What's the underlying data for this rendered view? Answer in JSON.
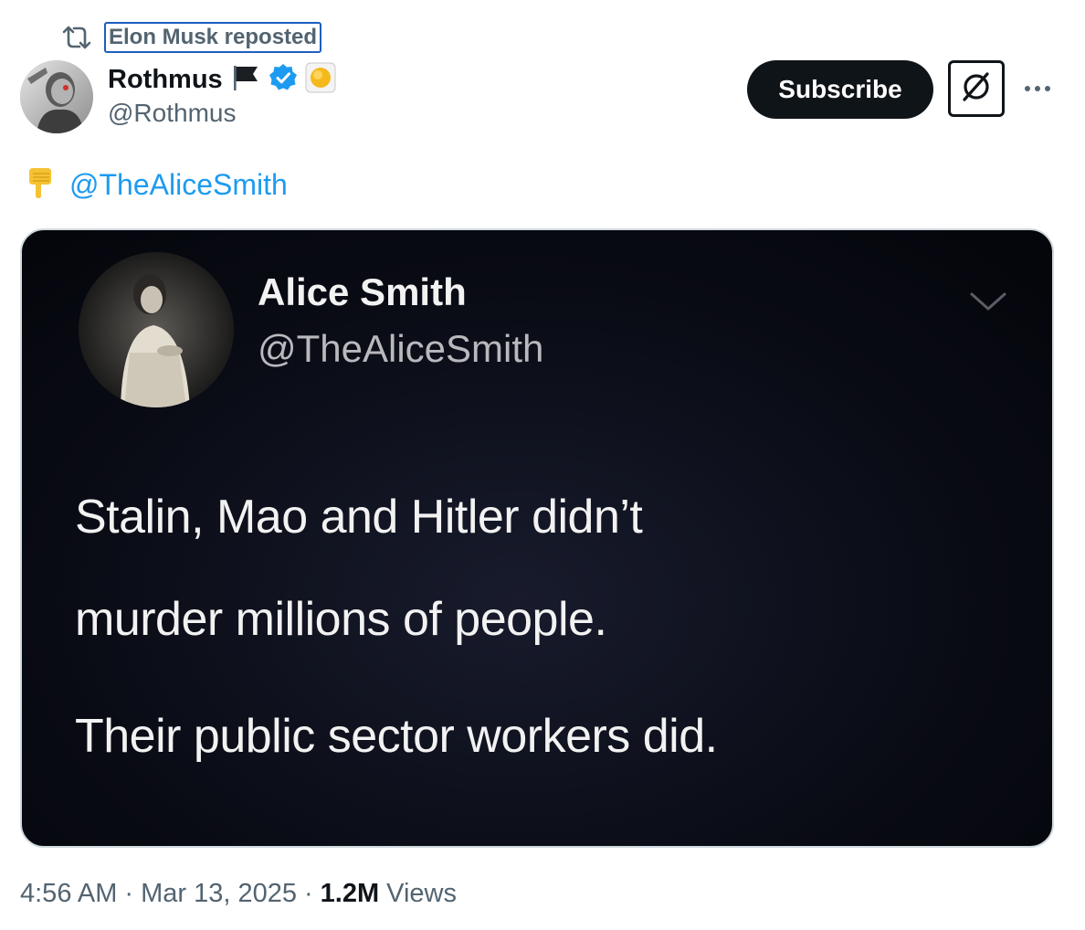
{
  "repost": {
    "icon": "repost-icon",
    "label": "Elon Musk reposted"
  },
  "post": {
    "author": {
      "display_name": "Rothmus",
      "handle": "@Rothmus",
      "badges": [
        "flag-icon",
        "verified-badge-icon",
        "yellow-circle-icon"
      ],
      "verified_color": "#1d9bf0"
    },
    "subscribe_label": "Subscribe",
    "grok_icon": "grok-icon",
    "more_icon": "more-options-icon",
    "text": {
      "emoji": "👇",
      "mention": "@TheAliceSmith"
    },
    "media": {
      "author_name": "Alice Smith",
      "author_handle": "@TheAliceSmith",
      "lines": [
        "Stalin, Mao and Hitler didn’t",
        "murder millions of people.",
        "Their public sector workers did."
      ]
    },
    "meta": {
      "time": "4:56 AM",
      "separator": "·",
      "date": "Mar 13, 2025",
      "views_count": "1.2M",
      "views_label": "Views"
    }
  },
  "colors": {
    "link": "#1d9bf0",
    "secondary_text": "#536471",
    "primary_text": "#0f1419",
    "button_bg": "#0f1419"
  }
}
